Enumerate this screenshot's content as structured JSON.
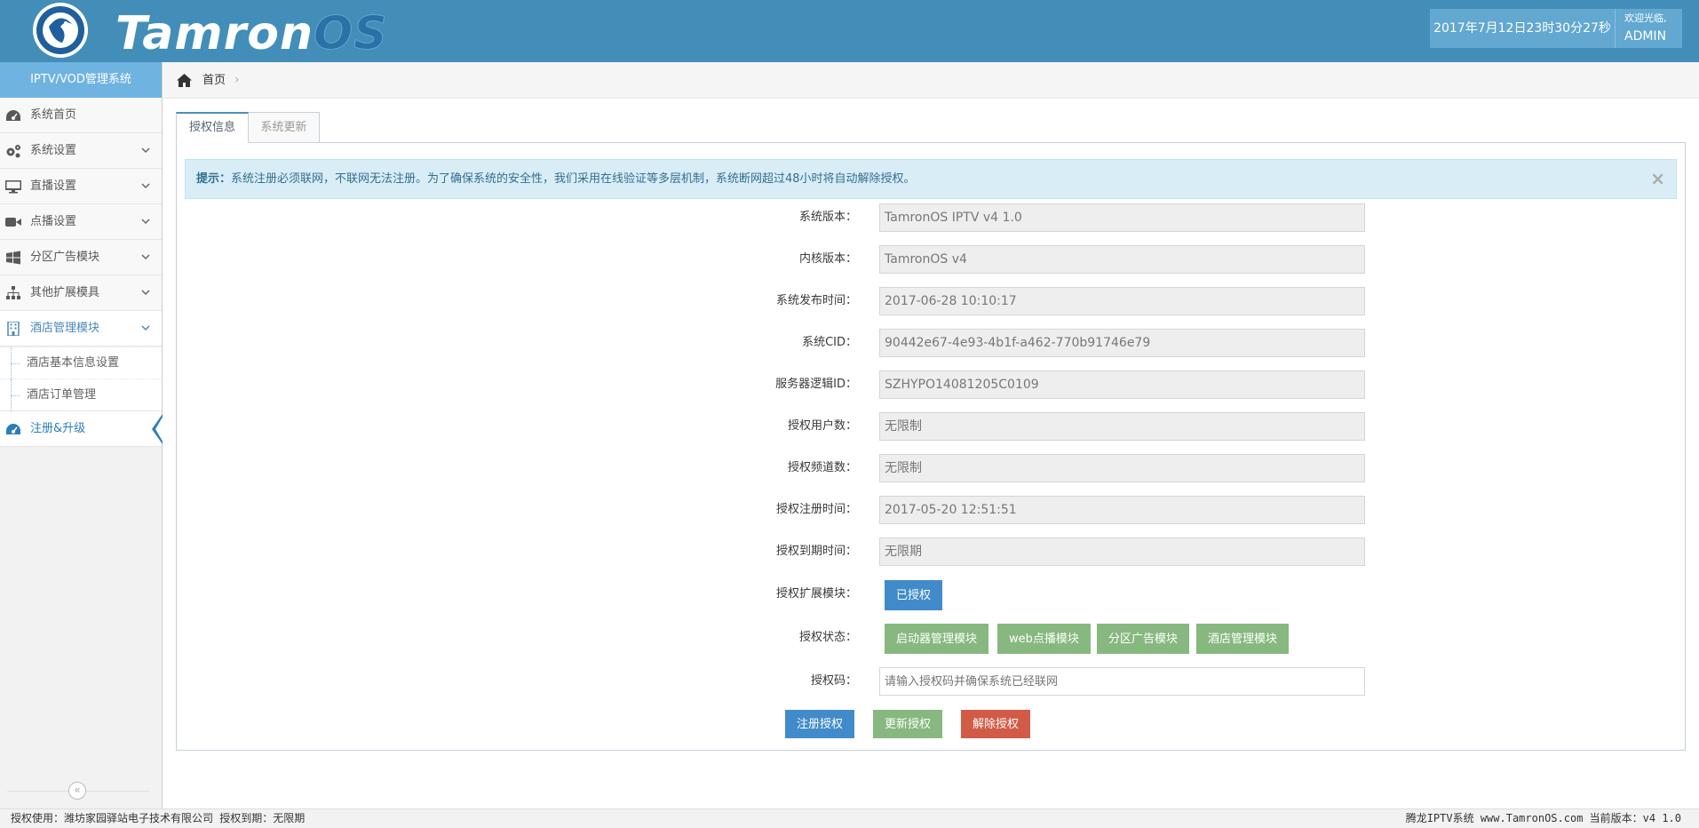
{
  "header": {
    "brand_main": "Tamron",
    "brand_suffix": "OS",
    "datetime": "2017年7月12日23时30分27秒",
    "welcome": "欢迎光临,",
    "username": "ADMIN"
  },
  "sidebar": {
    "title": "IPTV/VOD管理系统",
    "items": [
      {
        "label": "系统首页",
        "icon": "dashboard-icon"
      },
      {
        "label": "系统设置",
        "icon": "gears-icon"
      },
      {
        "label": "直播设置",
        "icon": "desktop-icon"
      },
      {
        "label": "点播设置",
        "icon": "video-camera-icon"
      },
      {
        "label": "分区广告模块",
        "icon": "windows-icon"
      },
      {
        "label": "其他扩展模具",
        "icon": "sitemap-icon"
      },
      {
        "label": "酒店管理模块",
        "icon": "building-icon"
      },
      {
        "label": "注册&升级",
        "icon": "dashboard-icon"
      }
    ],
    "hotel_sub": [
      "酒店基本信息设置",
      "酒店订单管理"
    ],
    "collapse": "«"
  },
  "breadcrumb": {
    "home": "首页",
    "sep": "›"
  },
  "tabs": [
    "授权信息",
    "系统更新"
  ],
  "alert": {
    "prefix": "提示：",
    "text": "系统注册必须联网，不联网无法注册。为了确保系统的安全性，我们采用在线验证等多层机制，系统断网超过48小时将自动解除授权。",
    "close": "×"
  },
  "form": {
    "fields": [
      {
        "label": "系统版本：",
        "value": "TamronOS IPTV v4 1.0"
      },
      {
        "label": "内核版本：",
        "value": "TamronOS v4"
      },
      {
        "label": "系统发布时间：",
        "value": "2017-06-28 10:10:17"
      },
      {
        "label": "系统CID：",
        "value": "90442e67-4e93-4b1f-a462-770b91746e79"
      },
      {
        "label": "服务器逻辑ID：",
        "value": "SZHYPO14081205C0109"
      },
      {
        "label": "授权用户数：",
        "value": "无限制"
      },
      {
        "label": "授权频道数：",
        "value": "无限制"
      },
      {
        "label": "授权注册时间：",
        "value": "2017-05-20 12:51:51"
      },
      {
        "label": "授权到期时间：",
        "value": "无限期"
      }
    ],
    "ext_label": "授权扩展模块：",
    "ext_button": "已授权",
    "status_label": "授权状态：",
    "status_modules": [
      "启动器管理模块",
      "web点播模块",
      "分区广告模块",
      "酒店管理模块"
    ],
    "code_label": "授权码：",
    "code_placeholder": "请输入授权码并确保系统已经联网",
    "actions": {
      "register": "注册授权",
      "update": "更新授权",
      "revoke": "解除授权"
    }
  },
  "footer": {
    "left": "授权使用：潍坊家园驿站电子技术有限公司 授权到期：无限期",
    "right": "腾龙IPTV系统 www.TamronOS.com 当前版本：v4 1.0"
  },
  "colors": {
    "header_bg": "#438eb9",
    "sidebar_title_bg": "#6fb3e0",
    "primary": "#428bca",
    "success": "#87b87f",
    "danger": "#d15b47",
    "alert_bg": "#d9edf7"
  }
}
